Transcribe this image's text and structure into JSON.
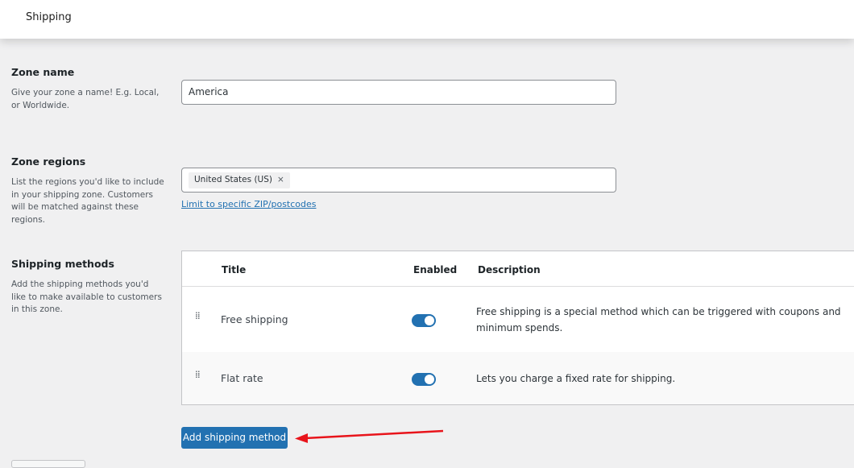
{
  "header": {
    "title": "Shipping"
  },
  "zone_name": {
    "label": "Zone name",
    "description": "Give your zone a name! E.g. Local, or Worldwide.",
    "value": "America"
  },
  "zone_regions": {
    "label": "Zone regions",
    "description": "List the regions you'd like to include in your shipping zone. Customers will be matched against these regions.",
    "chips": [
      {
        "label": "United States (US)",
        "remove": "×"
      }
    ],
    "limit_link": "Limit to specific ZIP/postcodes"
  },
  "shipping_methods": {
    "label": "Shipping methods",
    "description": "Add the shipping methods you'd like to make available to customers in this zone.",
    "columns": {
      "title": "Title",
      "enabled": "Enabled",
      "description": "Description"
    },
    "rows": [
      {
        "title": "Free shipping",
        "enabled": true,
        "description": "Free shipping is a special method which can be triggered with coupons and minimum spends."
      },
      {
        "title": "Flat rate",
        "enabled": true,
        "description": "Lets you charge a fixed rate for shipping."
      }
    ],
    "add_button": "Add shipping method"
  },
  "colors": {
    "accent": "#2271b1",
    "annotation_arrow": "#e8141b"
  }
}
